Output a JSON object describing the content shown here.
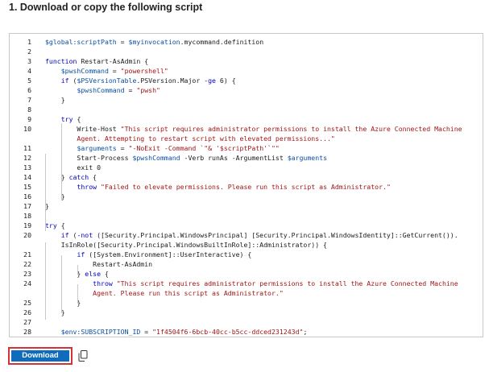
{
  "heading": "1. Download or copy the following script",
  "download_label": "Download",
  "icons": {
    "copy": "copy-icon"
  },
  "colors": {
    "keyword": "#0000c8",
    "variable": "#0a4fa3",
    "string": "#a31515",
    "button": "#0f6cbd",
    "highlight_border": "#d13438"
  },
  "code_lines": [
    {
      "n": "1",
      "tokens": [
        [
          "v",
          "$global:scriptPath"
        ],
        [
          "t",
          " = "
        ],
        [
          "v",
          "$myinvocation"
        ],
        [
          "t",
          ".mycommand.definition"
        ]
      ]
    },
    {
      "n": "2",
      "tokens": []
    },
    {
      "n": "3",
      "tokens": [
        [
          "k",
          "function"
        ],
        [
          "t",
          " Restart-AsAdmin {"
        ]
      ]
    },
    {
      "n": "4",
      "tokens": [
        [
          "t",
          "    "
        ],
        [
          "v",
          "$pwshCommand"
        ],
        [
          "t",
          " = "
        ],
        [
          "s",
          "\"powershell\""
        ]
      ]
    },
    {
      "n": "5",
      "tokens": [
        [
          "t",
          "    "
        ],
        [
          "k",
          "if"
        ],
        [
          "t",
          " ("
        ],
        [
          "v",
          "$PSVersionTable"
        ],
        [
          "t",
          ".PSVersion.Major "
        ],
        [
          "k",
          "-ge"
        ],
        [
          "t",
          " 6) {"
        ]
      ]
    },
    {
      "n": "6",
      "tokens": [
        [
          "t",
          "        "
        ],
        [
          "v",
          "$pwshCommand"
        ],
        [
          "t",
          " = "
        ],
        [
          "s",
          "\"pwsh\""
        ]
      ]
    },
    {
      "n": "7",
      "tokens": [
        [
          "t",
          "    }"
        ]
      ]
    },
    {
      "n": "8",
      "tokens": []
    },
    {
      "n": "9",
      "tokens": [
        [
          "t",
          "    "
        ],
        [
          "k",
          "try"
        ],
        [
          "t",
          " {"
        ]
      ]
    },
    {
      "n": "10",
      "tokens": [
        [
          "t",
          "        Write-Host "
        ],
        [
          "s",
          "\"This script requires administrator permissions to install the Azure Connected Machine"
        ]
      ]
    },
    {
      "n": "",
      "tokens": [
        [
          "s",
          "        Agent. Attempting to restart script with elevated permissions...\""
        ]
      ]
    },
    {
      "n": "11",
      "tokens": [
        [
          "t",
          "        "
        ],
        [
          "v",
          "$arguments"
        ],
        [
          "t",
          " = "
        ],
        [
          "s",
          "\"-NoExit -Command `\"& '$scriptPath'`\"\""
        ]
      ]
    },
    {
      "n": "12",
      "tokens": [
        [
          "t",
          "        Start-Process "
        ],
        [
          "v",
          "$pwshCommand"
        ],
        [
          "t",
          " -Verb runAs -ArgumentList "
        ],
        [
          "v",
          "$arguments"
        ]
      ]
    },
    {
      "n": "13",
      "tokens": [
        [
          "t",
          "        exit 0"
        ]
      ]
    },
    {
      "n": "14",
      "tokens": [
        [
          "t",
          "    } "
        ],
        [
          "k",
          "catch"
        ],
        [
          "t",
          " {"
        ]
      ]
    },
    {
      "n": "15",
      "tokens": [
        [
          "t",
          "        "
        ],
        [
          "k",
          "throw"
        ],
        [
          "t",
          " "
        ],
        [
          "s",
          "\"Failed to elevate permissions. Please run this script as Administrator.\""
        ]
      ]
    },
    {
      "n": "16",
      "tokens": [
        [
          "t",
          "    }"
        ]
      ]
    },
    {
      "n": "17",
      "tokens": [
        [
          "t",
          "}"
        ]
      ]
    },
    {
      "n": "18",
      "tokens": []
    },
    {
      "n": "19",
      "tokens": [
        [
          "k",
          "try"
        ],
        [
          "t",
          " {"
        ]
      ]
    },
    {
      "n": "20",
      "tokens": [
        [
          "t",
          "    "
        ],
        [
          "k",
          "if"
        ],
        [
          "t",
          " ("
        ],
        [
          "k",
          "-not"
        ],
        [
          "t",
          " ([Security.Principal.WindowsPrincipal] [Security.Principal.WindowsIdentity]::GetCurrent())."
        ]
      ]
    },
    {
      "n": "",
      "tokens": [
        [
          "t",
          "    IsInRole([Security.Principal.WindowsBuiltInRole]::Administrator)) {"
        ]
      ]
    },
    {
      "n": "21",
      "tokens": [
        [
          "t",
          "        "
        ],
        [
          "k",
          "if"
        ],
        [
          "t",
          " ([System.Environment]::UserInteractive) {"
        ]
      ]
    },
    {
      "n": "22",
      "tokens": [
        [
          "t",
          "            Restart-AsAdmin"
        ]
      ]
    },
    {
      "n": "23",
      "tokens": [
        [
          "t",
          "        } "
        ],
        [
          "k",
          "else"
        ],
        [
          "t",
          " {"
        ]
      ]
    },
    {
      "n": "24",
      "tokens": [
        [
          "t",
          "            "
        ],
        [
          "k",
          "throw"
        ],
        [
          "t",
          " "
        ],
        [
          "s",
          "\"This script requires administrator permissions to install the Azure Connected Machine"
        ]
      ]
    },
    {
      "n": "",
      "tokens": [
        [
          "s",
          "            Agent. Please run this script as Administrator.\""
        ]
      ]
    },
    {
      "n": "25",
      "tokens": [
        [
          "t",
          "        }"
        ]
      ]
    },
    {
      "n": "26",
      "tokens": [
        [
          "t",
          "    }"
        ]
      ]
    },
    {
      "n": "27",
      "tokens": []
    },
    {
      "n": "28",
      "tokens": [
        [
          "t",
          "    "
        ],
        [
          "v",
          "$env:SUBSCRIPTION_ID"
        ],
        [
          "t",
          " = "
        ],
        [
          "s",
          "\"1f4504f6-6bcb-40cc-b5cc-ddced231243d\""
        ],
        [
          "t",
          ";"
        ]
      ]
    }
  ]
}
